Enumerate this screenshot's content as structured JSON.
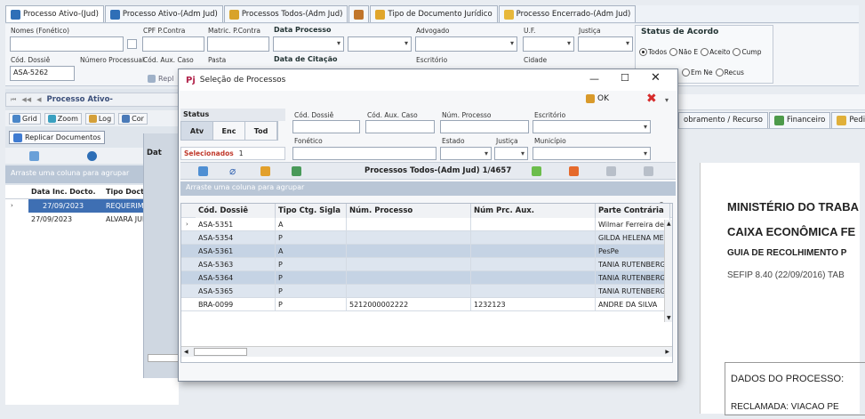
{
  "tabs": [
    {
      "label": "Processo Ativo-(Jud)",
      "icon": "process-icon",
      "color": "#2f6fb7"
    },
    {
      "label": "Processo Ativo-(Adm Jud)",
      "icon": "process-icon",
      "color": "#2f6fb7"
    },
    {
      "label": "Processos Todos-(Adm Jud)",
      "icon": "folders-icon",
      "color": "#d8a32a"
    },
    {
      "label": "",
      "icon": "tools-icon",
      "color": "#c0752b"
    },
    {
      "label": "Tipo de Documento Jurídico",
      "icon": "document-icon",
      "color": "#e0a62c"
    },
    {
      "label": "Processo Encerrado-(Adm Jud)",
      "icon": "folder-icon",
      "color": "#e7b83b"
    }
  ],
  "filters": {
    "nomes": "Nomes (Fonético)",
    "cpf": "CPF P.Contra",
    "matric": "Matric. P.Contra",
    "data_processo": "Data Processo",
    "advogado": "Advogado",
    "uf": "U.F.",
    "justica": "Justiça",
    "cod_dossie": "Cód. Dossiê",
    "cod_dossie_value": "ASA-5262",
    "num_processual": "Número Processual",
    "cod_aux": "Cód. Aux. Caso",
    "pasta": "Pasta",
    "data_citacao": "Data de Citação",
    "escritorio": "Escritório",
    "cidade": "Cidade"
  },
  "status_acordo": {
    "title": "Status de Acordo",
    "options": [
      "Todos",
      "Não E",
      "Aceito",
      "Cump",
      "Em Ne",
      "Recus"
    ]
  },
  "left": {
    "nav_label": "Processo Ativo-",
    "toolbar": [
      "Grid",
      "Zoom",
      "Log",
      "Cor"
    ],
    "replicar": "Replicar Documentos",
    "rep_short": "Repl",
    "group_hint": "Arraste uma coluna para agrupar",
    "headers": [
      "Data Inc. Docto.",
      "Tipo Docto"
    ],
    "rows": [
      [
        "27/09/2023",
        "REQUERIME"
      ],
      [
        "27/09/2023",
        "ALVARÁ JUD"
      ]
    ],
    "dat_label": "Dat"
  },
  "right": {
    "tabs": [
      "obramento / Recurso",
      "Financeiro",
      "Pedido / V"
    ]
  },
  "doc": {
    "l1": "MINISTÉRIO DO TRABA",
    "l2": "CAIXA ECONÔMICA FE",
    "l3": "GUIA DE RECOLHIMENTO P",
    "l4": "SEFIP 8.40 (22/09/2016)  TAB",
    "l5": "DADOS DO PROCESSO:",
    "l6": "RECLAMADA:    VIACAO PE"
  },
  "dialog": {
    "title": "Seleção de Processos",
    "ok": "OK",
    "status": "Status",
    "status_tabs": [
      "Atv",
      "Enc",
      "Tod"
    ],
    "selecionados": "Selecionados",
    "selecionados_count": "1",
    "labels": {
      "cod_dossie": "Cód. Dossiê",
      "cod_aux": "Cód. Aux. Caso",
      "num_processo": "Núm. Processo",
      "escritorio": "Escritório",
      "fonetico": "Fonético",
      "estado": "Estado",
      "justica": "Justiça",
      "municipio": "Município"
    },
    "grid_title": "Processos Todos-(Adm Jud) 1/4657",
    "group_hint": "Arraste uma coluna para agrupar",
    "columns": [
      "Cód. Dossiê",
      "Tipo Ctg. Sigla",
      "Núm. Processo",
      "Núm Prc. Aux.",
      "Parte Contrária"
    ],
    "rows": [
      [
        "ASA-5351",
        "A",
        "",
        "",
        "Wilmar Ferreira de"
      ],
      [
        "ASA-5354",
        "P",
        "",
        "",
        "GILDA HELENA ME"
      ],
      [
        "ASA-5361",
        "A",
        "",
        "",
        "PesPe"
      ],
      [
        "ASA-5363",
        "P",
        "",
        "",
        "TANIA RUTENBERG"
      ],
      [
        "ASA-5364",
        "P",
        "",
        "",
        "TANIA RUTENBERG"
      ],
      [
        "ASA-5365",
        "P",
        "",
        "",
        "TANIA RUTENBERG"
      ],
      [
        "BRA-0099",
        "P",
        "5212000002222",
        "1232123",
        "ANDRE  DA SILVA"
      ]
    ]
  }
}
